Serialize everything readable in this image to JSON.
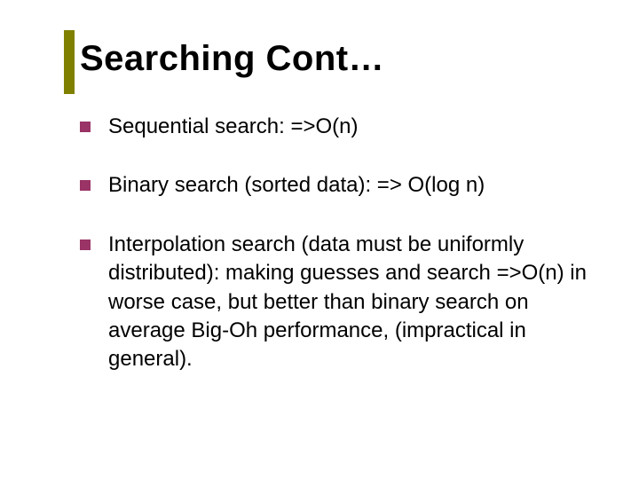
{
  "title": "Searching Cont…",
  "bullets": [
    {
      "text": "Sequential search: =>O(n)"
    },
    {
      "text": "Binary search (sorted data): => O(log n)"
    },
    {
      "text": "Interpolation search (data must be uniformly distributed):\nmaking guesses and search =>O(n) in worse case, but better than binary search on average Big-Oh performance, (impractical in general)."
    }
  ]
}
